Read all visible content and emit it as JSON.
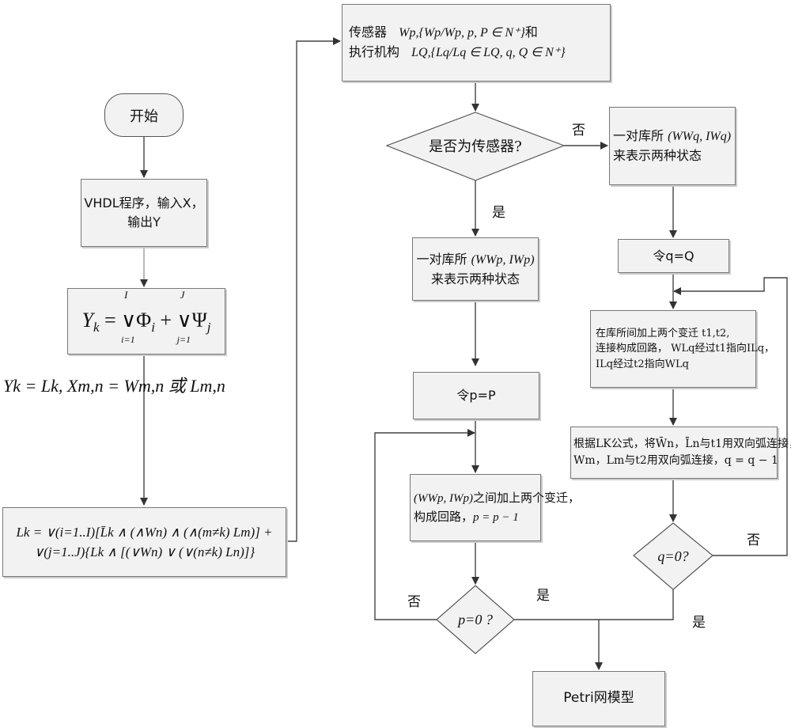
{
  "flowchart": {
    "start": "开始",
    "vhdl": {
      "line1": "VHDL程序，输入X，",
      "line2": "输出Y"
    },
    "yk_formula": "Yk = ∨(i=1..I) Φi + ∨(j=1..J) Ψj",
    "yk_formula_parts": {
      "lhs": "Y",
      "lhs_sub": "k",
      "op1": "∨",
      "upper1": "I",
      "lower1": "i=1",
      "phi": "Φ",
      "phi_sub": "i",
      "plus": "+",
      "op2": "∨",
      "upper2": "J",
      "lower2": "j=1",
      "psi": "Ψ",
      "psi_sub": "j"
    },
    "side_formula": "Yk = Lk, Xm,n = Wm,n 或 Lm,n",
    "lk_formula": "Lk = ∨(i=1..I)[L̄k ∧ (∧Wn) ∧ (∧(m≠k) Lm)] + ∨(j=1..J){Lk ∧ [(∨Wn) ∨ (∨(n≠k) Ln)]}",
    "sensor_actuator": {
      "line1_label": "传感器",
      "line1_math": "Wp,{Wp/Wp, p, P ∈ N⁺}",
      "line1_suffix": "和",
      "line2_label": "执行机构",
      "line2_math": "LQ,{Lq/Lq ∈ LQ, q, Q ∈ N⁺}"
    },
    "decision_sensor": "是否为传感器?",
    "yes": "是",
    "no": "否",
    "left_branch": {
      "place_pair_line1": "一对库所",
      "place_pair_math": "(WWp, IWp)",
      "place_pair_line2": "来表示两种状态",
      "set_p": "令p=P",
      "loop_line1_math": "(WWp, IWp)",
      "loop_line1_text": "之间加上两个变迁，",
      "loop_line2_text": "构成回路，",
      "loop_line2_math": "p = p − 1",
      "decision": "p=0 ?"
    },
    "right_branch": {
      "place_pair_line1": "一对库所",
      "place_pair_math": "(WWq, IWq)",
      "place_pair_line2": "来表示两种状态",
      "set_q": "令q=Q",
      "transitions_line1": "在库所间加上两个变迁 t1,t2,",
      "transitions_line2": "连接构成回路， WLq经过t1指向ILq，",
      "transitions_line3": "ILq经过t2指向WLq",
      "connect_line1": "根据LK公式，将W̄n，L̄n与t1用双向弧连接，",
      "connect_line2": "Wm，Lm与t2用双向弧连接，q = q − 1",
      "decision": "q=0?"
    },
    "end": "Petri网模型"
  }
}
